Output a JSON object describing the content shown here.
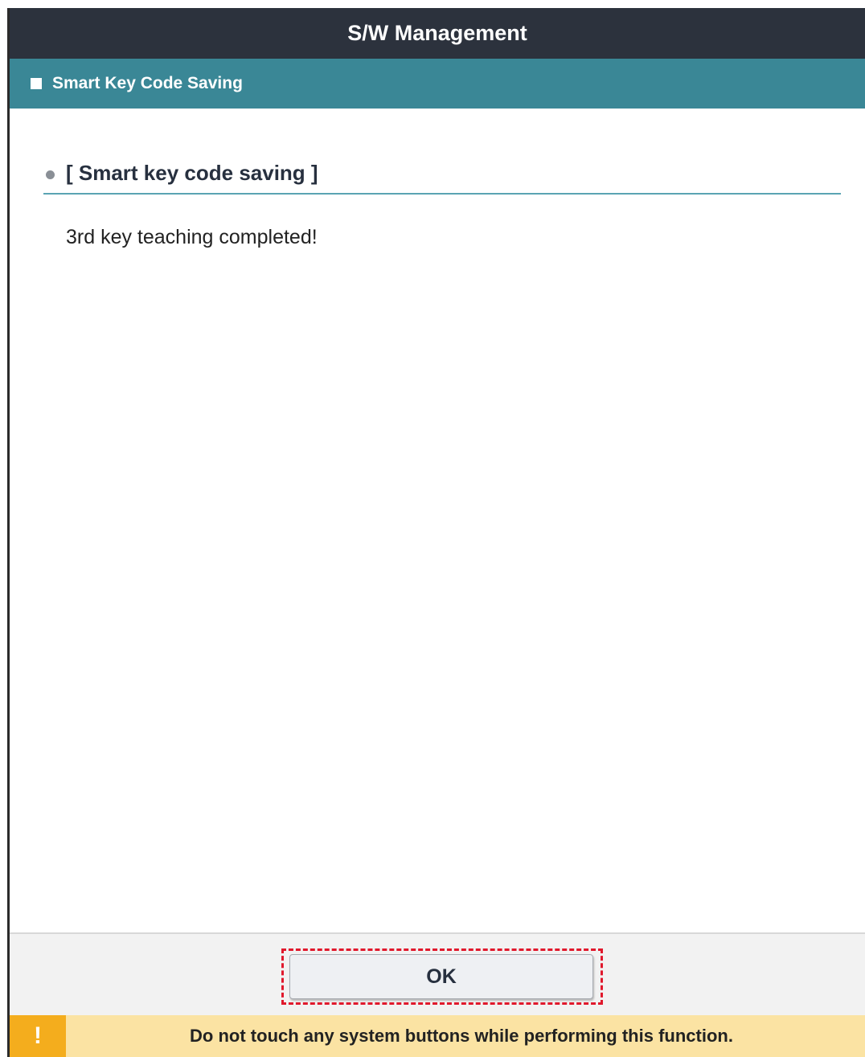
{
  "window": {
    "title": "S/W Management"
  },
  "subheader": {
    "title": "Smart Key Code Saving"
  },
  "section": {
    "heading": "[ Smart key code saving ]",
    "message": "3rd key teaching completed!"
  },
  "footer": {
    "ok_label": "OK"
  },
  "warning": {
    "icon_glyph": "!",
    "icon_name": "warning-icon",
    "text": "Do not touch any system buttons while performing this function."
  },
  "colors": {
    "title_bar": "#2c323d",
    "subheader": "#3a8796",
    "divider": "#5aa4b3",
    "highlight": "#e0182c",
    "warning_bg": "#fbe3a3",
    "warning_icon_bg": "#f4ad1d"
  }
}
